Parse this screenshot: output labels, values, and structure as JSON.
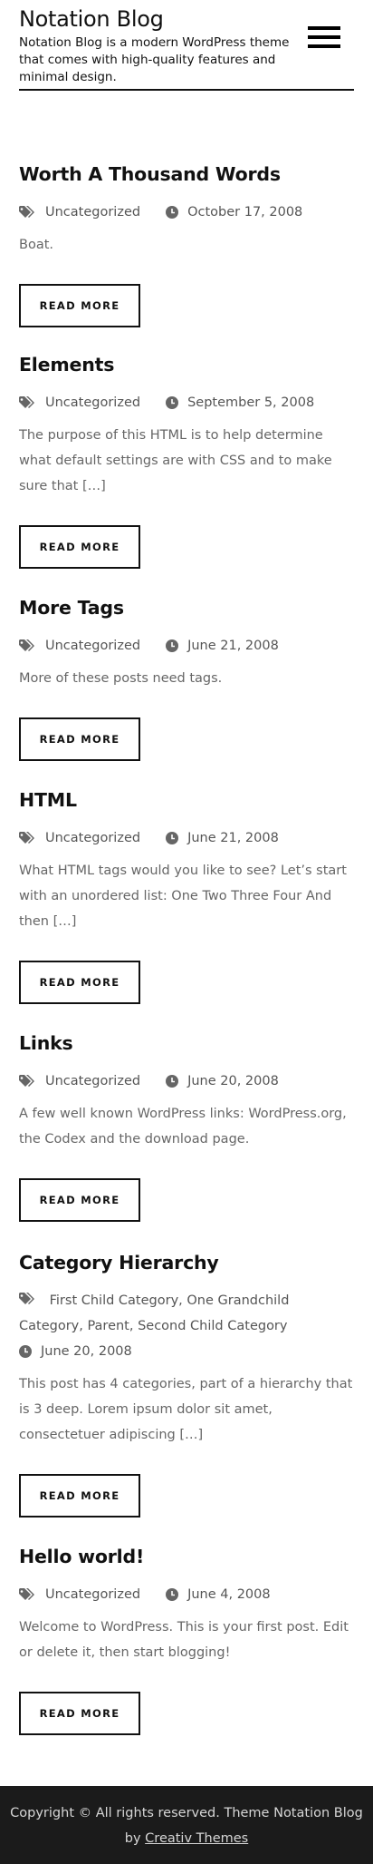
{
  "site": {
    "title": "Notation Blog",
    "description": "Notation Blog is a modern WordPress theme that comes with high-quality features and minimal design."
  },
  "posts": [
    {
      "title": "Worth A Thousand Words",
      "category": "Uncategorized",
      "date": "October 17, 2008",
      "excerpt": "Boat.",
      "button": "READ MORE"
    },
    {
      "title": "Elements",
      "category": "Uncategorized",
      "date": "September 5, 2008",
      "excerpt": "The purpose of this HTML is to help determine what default settings are with CSS and to make sure that […]",
      "button": "READ MORE"
    },
    {
      "title": "More Tags",
      "category": "Uncategorized",
      "date": "June 21, 2008",
      "excerpt": "More of these posts need tags.",
      "button": "READ MORE"
    },
    {
      "title": "HTML",
      "category": "Uncategorized",
      "date": "June 21, 2008",
      "excerpt": "What HTML tags would you like to see? Let’s start with an unordered list: One Two Three Four And then […]",
      "button": "READ MORE"
    },
    {
      "title": "Links",
      "category": "Uncategorized",
      "date": "June 20, 2008",
      "excerpt": "A few well known WordPress links: WordPress.org, the Codex and the download page.",
      "button": "READ MORE"
    },
    {
      "title": "Category Hierarchy",
      "category": "First Child Category, One Grandchild Category, Parent, Second Child Category",
      "date": "June 20, 2008",
      "excerpt": "This post has 4 categories, part of a hierarchy that is 3 deep. Lorem ipsum dolor sit amet, consectetuer adipiscing […]",
      "button": "READ MORE"
    },
    {
      "title": "Hello world!",
      "category": "Uncategorized",
      "date": "June 4, 2008",
      "excerpt": "Welcome to WordPress. This is your first post. Edit or delete it, then start blogging!",
      "button": "READ MORE"
    }
  ],
  "footer": {
    "copyright": "Copyright © All rights reserved. Theme Notation Blog",
    "by": "by",
    "author_link": "Creativ Themes"
  },
  "icons": {
    "category": "tags-icon",
    "date": "clock-icon",
    "menu": "hamburger-menu-icon"
  }
}
